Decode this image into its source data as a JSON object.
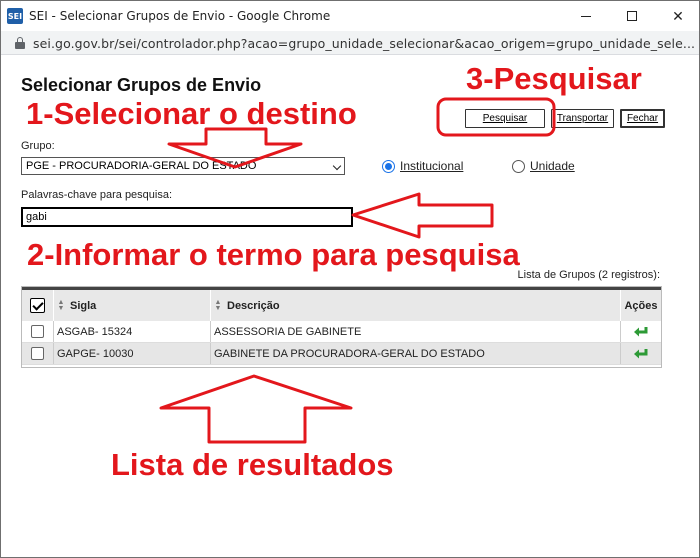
{
  "window": {
    "app_icon_text": "SEI",
    "title": "SEI - Selecionar Grupos de Envio - Google Chrome",
    "url": "sei.go.gov.br/sei/controlador.php?acao=grupo_unidade_selecionar&acao_origem=grupo_unidade_sele..."
  },
  "page": {
    "title": "Selecionar Grupos de Envio",
    "buttons": {
      "pesquisar": "Pesquisar",
      "transportar": "Transportar",
      "fechar": "Fechar"
    },
    "grupo_label": "Grupo:",
    "grupo_selected": "PGE - PROCURADORIA-GERAL DO ESTADO",
    "radio_institucional": "Institucional",
    "radio_unidade": "Unidade",
    "radio_selected": "Institucional",
    "palavras_label": "Palavras-chave para pesquisa:",
    "palavras_value": "gabi",
    "lista_caption": "Lista de Grupos (2 registros):"
  },
  "table": {
    "headers": {
      "sigla": "Sigla",
      "descricao": "Descrição",
      "acoes": "Ações"
    },
    "rows": [
      {
        "sigla": "ASGAB- 15324",
        "descricao": "ASSESSORIA DE GABINETE"
      },
      {
        "sigla": "GAPGE- 10030",
        "descricao": "GABINETE DA PROCURADORA-GERAL DO ESTADO"
      }
    ]
  },
  "annotations": {
    "step1": "1-Selecionar o destino",
    "step2": "2-Informar o termo para pesquisa",
    "step3": "3-Pesquisar",
    "lista": "Lista de resultados",
    "color": "#e3171c"
  },
  "icons": {
    "app": "sei-logo-icon",
    "lock": "lock-icon",
    "row_action": "transport-arrow-icon"
  }
}
